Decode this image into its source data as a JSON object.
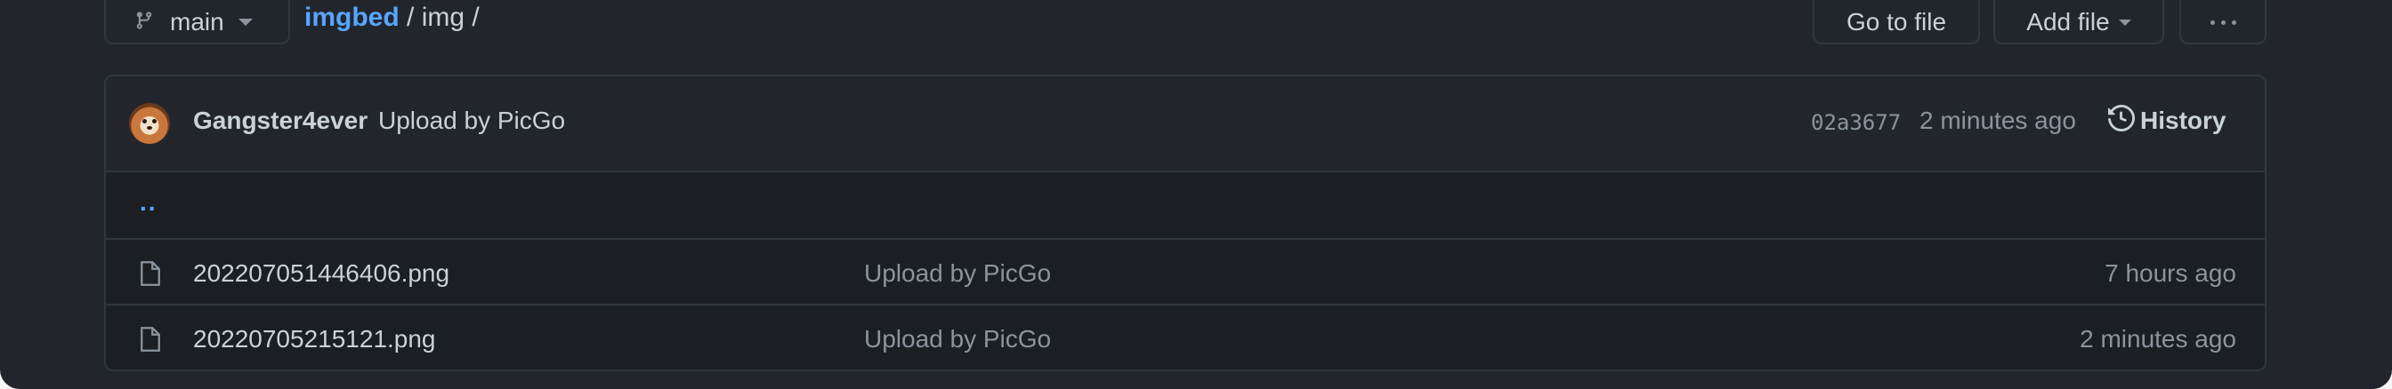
{
  "top_bar": {
    "branch": {
      "icon": "git-branch-icon",
      "name": "main"
    },
    "breadcrumb": {
      "repo": "imgbed",
      "separator1": " / ",
      "folder": "img",
      "separator2": " /"
    },
    "go_to_file_label": "Go to file",
    "add_file_label": "Add file",
    "more_icon": "kebab-horizontal-icon"
  },
  "commit": {
    "author": "Gangster4ever",
    "message": "Upload by PicGo",
    "sha": "02a3677",
    "time": "2 minutes ago",
    "history_label": "History",
    "history_icon": "history-icon"
  },
  "files": {
    "up_link": "..",
    "rows": [
      {
        "name": "202207051446406.png",
        "commit_message": "Upload by PicGo",
        "time": "7 hours ago",
        "icon": "file-icon"
      },
      {
        "name": "20220705215121.png",
        "commit_message": "Upload by PicGo",
        "time": "2 minutes ago",
        "icon": "file-icon"
      }
    ]
  },
  "colors": {
    "background": "#22262c",
    "link": "#58a6ff",
    "text": "#c9d1d9",
    "muted": "#8b949e",
    "border": "#30363d"
  }
}
